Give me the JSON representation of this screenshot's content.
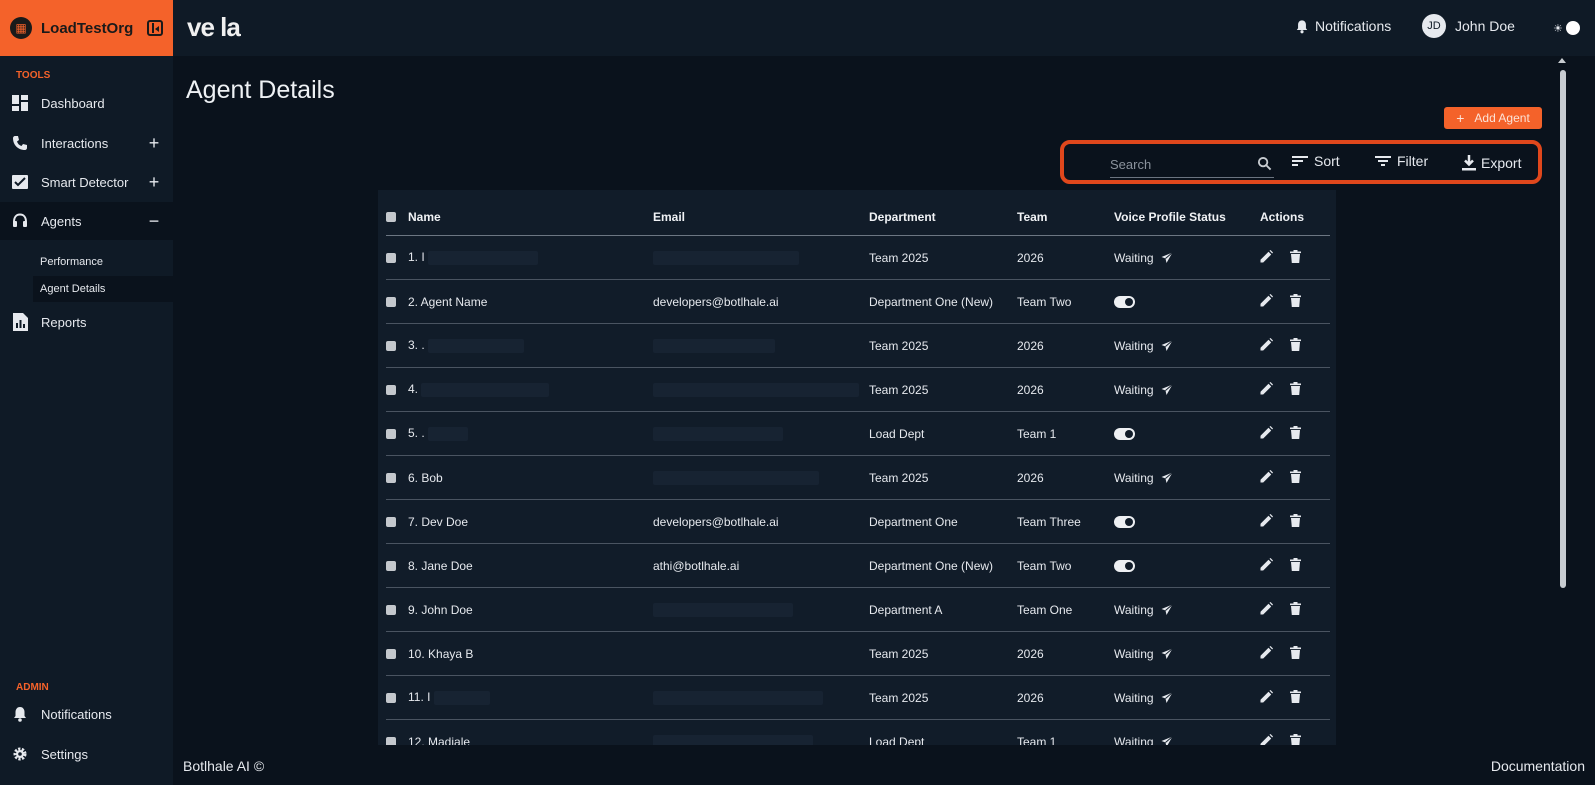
{
  "org": {
    "name": "LoadTestOrg"
  },
  "brand": {
    "logo_text": "ve  la",
    "logo_wave": "·|·||·"
  },
  "sidebar": {
    "tools_label": "TOOLS",
    "admin_label": "ADMIN",
    "items": [
      {
        "label": "Dashboard",
        "icon": "dashboard-icon",
        "toggle": ""
      },
      {
        "label": "Interactions",
        "icon": "phone-icon",
        "toggle": "+"
      },
      {
        "label": "Smart Detector",
        "icon": "detector-icon",
        "toggle": "+"
      },
      {
        "label": "Agents",
        "icon": "headset-icon",
        "toggle": "−"
      },
      {
        "label": "Reports",
        "icon": "report-icon",
        "toggle": ""
      }
    ],
    "sub_items": [
      {
        "label": "Performance"
      },
      {
        "label": "Agent Details"
      }
    ],
    "admin_items": [
      {
        "label": "Notifications",
        "icon": "bell-icon"
      },
      {
        "label": "Settings",
        "icon": "gear-icon"
      }
    ]
  },
  "topbar": {
    "notifications_label": "Notifications",
    "user_initials": "JD",
    "user_name": "John Doe",
    "theme_icon": "☀"
  },
  "main": {
    "title": "Agent Details",
    "add_button": "Add Agent",
    "add_plus": "+",
    "search_placeholder": "Search",
    "sort_label": "Sort",
    "filter_label": "Filter",
    "export_label": "Export"
  },
  "table": {
    "headers": [
      "Name",
      "Email",
      "Department",
      "Team",
      "Voice Profile Status",
      "Actions"
    ],
    "rows": [
      {
        "name": "1. I",
        "email": "",
        "department": "Team 2025",
        "team": "2026",
        "status": "Waiting",
        "toggle": false
      },
      {
        "name": "2. Agent Name",
        "email": "developers@botlhale.ai",
        "department": "Department One (New)",
        "team": "Team Two",
        "status": "",
        "toggle": true
      },
      {
        "name": "3. .",
        "email": "",
        "department": "Team 2025",
        "team": "2026",
        "status": "Waiting",
        "toggle": false
      },
      {
        "name": "4.",
        "email": "",
        "department": "Team 2025",
        "team": "2026",
        "status": "Waiting",
        "toggle": false
      },
      {
        "name": "5. .",
        "email": "",
        "department": "Load Dept",
        "team": "Team 1",
        "status": "",
        "toggle": true
      },
      {
        "name": "6. Bob",
        "email": "",
        "department": "Team 2025",
        "team": "2026",
        "status": "Waiting",
        "toggle": false
      },
      {
        "name": "7. Dev Doe",
        "email": "developers@botlhale.ai",
        "department": "Department One",
        "team": "Team Three",
        "status": "",
        "toggle": true
      },
      {
        "name": "8. Jane Doe",
        "email": "athi@botlhale.ai",
        "department": "Department One (New)",
        "team": "Team Two",
        "status": "",
        "toggle": true
      },
      {
        "name": "9. John Doe",
        "email": "",
        "department": "Department A",
        "team": "Team One",
        "status": "Waiting",
        "toggle": false
      },
      {
        "name": "10. Khaya B",
        "email": "",
        "department": "Team 2025",
        "team": "2026",
        "status": "Waiting",
        "toggle": false
      },
      {
        "name": "11. I",
        "email": "",
        "department": "Team 2025",
        "team": "2026",
        "status": "Waiting",
        "toggle": false
      },
      {
        "name": "12. Madiale",
        "email": "",
        "department": "Load Dept",
        "team": "Team 1",
        "status": "Waiting",
        "toggle": false
      }
    ]
  },
  "footer": {
    "left": "Botlhale AI ©",
    "right": "Documentation"
  },
  "colors": {
    "accent": "#f4622a",
    "background": "#0a121c",
    "panel": "#0f1a26",
    "table": "#111c29"
  }
}
